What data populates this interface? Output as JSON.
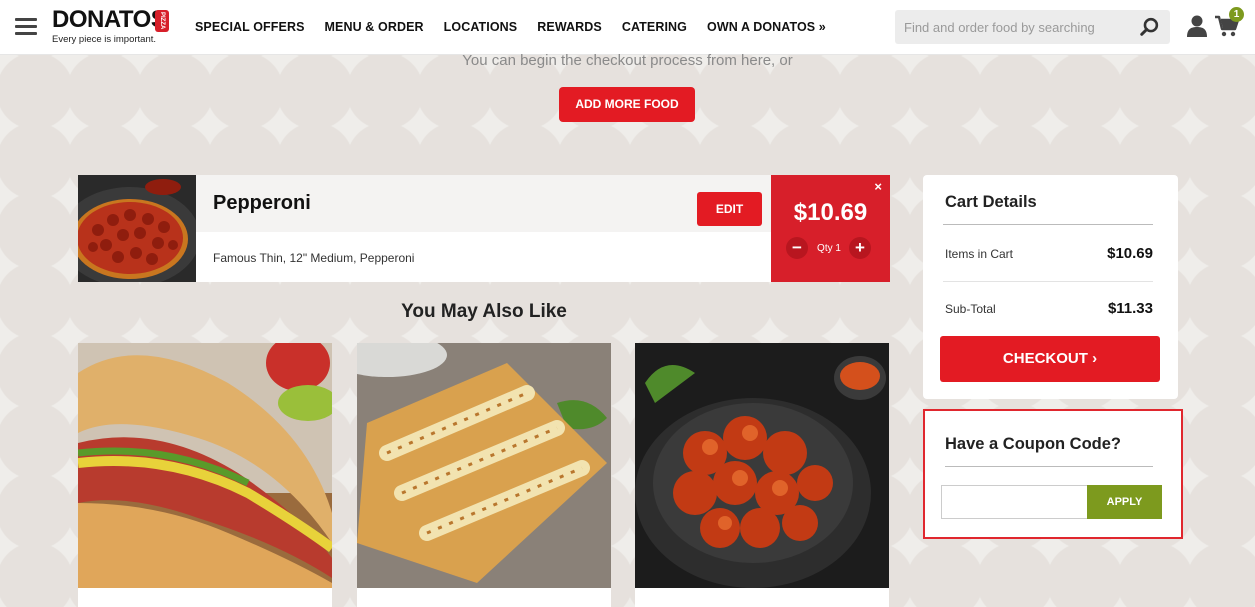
{
  "header": {
    "logo_text": "DONATOS",
    "logo_badge": "PIZZA",
    "tagline": "Every piece is important.",
    "nav": [
      "SPECIAL OFFERS",
      "MENU & ORDER",
      "LOCATIONS",
      "REWARDS",
      "CATERING",
      "OWN A DONATOS »"
    ],
    "search_placeholder": "Find and order food by searching",
    "cart_count": "1"
  },
  "checkout_prompt": {
    "text": "You can begin the checkout process from here, or",
    "button": "ADD MORE FOOD"
  },
  "cart_item": {
    "name": "Pepperoni",
    "edit_label": "EDIT",
    "description": "Famous Thin, 12\" Medium, Pepperoni",
    "price": "$10.69",
    "remove_symbol": "×",
    "minus_symbol": "−",
    "plus_symbol": "+",
    "qty_label": "Qty 1"
  },
  "recommendations": {
    "title": "You May Also Like",
    "items": [
      "sandwich",
      "breadsticks",
      "boneless-wings"
    ]
  },
  "cart_details": {
    "title": "Cart Details",
    "rows": [
      {
        "label": "Items in Cart",
        "value": "$10.69"
      },
      {
        "label": "Sub-Total",
        "value": "$11.33"
      }
    ],
    "checkout_label": "CHECKOUT ›"
  },
  "coupon": {
    "title": "Have a Coupon Code?",
    "input_value": "",
    "apply_label": "APPLY"
  },
  "colors": {
    "brand_red": "#e31b23",
    "price_red": "#d71f2a",
    "apply_green": "#7d9a1e",
    "highlight_border": "#e0272e"
  },
  "icons": [
    "menu-icon",
    "search-icon",
    "user-icon",
    "cart-icon",
    "close-icon",
    "chevron-right-icon"
  ]
}
